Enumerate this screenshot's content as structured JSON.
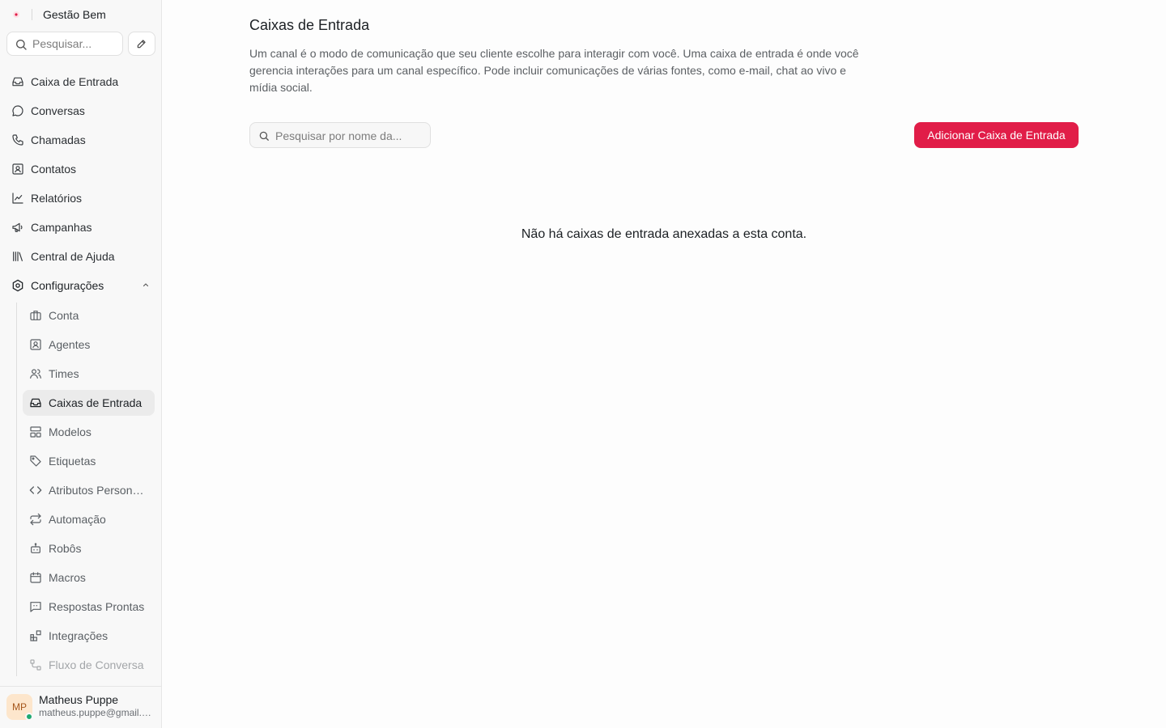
{
  "app": {
    "name": "Gestão Bem"
  },
  "colors": {
    "accent": "#e11d48",
    "online": "#1fa971",
    "avatar_bg": "#fde6cc"
  },
  "sidebar": {
    "search_placeholder": "Pesquisar...",
    "items": [
      {
        "label": "Caixa de Entrada",
        "icon": "inbox-icon"
      },
      {
        "label": "Conversas",
        "icon": "chat-bubble-icon"
      },
      {
        "label": "Chamadas",
        "icon": "phone-icon"
      },
      {
        "label": "Contatos",
        "icon": "contact-card-icon"
      },
      {
        "label": "Relatórios",
        "icon": "line-chart-icon"
      },
      {
        "label": "Campanhas",
        "icon": "megaphone-icon"
      },
      {
        "label": "Central de Ajuda",
        "icon": "library-icon"
      },
      {
        "label": "Configurações",
        "icon": "settings-icon",
        "expanded": true
      }
    ],
    "settings_items": [
      {
        "label": "Conta",
        "icon": "briefcase-icon"
      },
      {
        "label": "Agentes",
        "icon": "agent-icon"
      },
      {
        "label": "Times",
        "icon": "users-icon"
      },
      {
        "label": "Caixas de Entrada",
        "icon": "inbox-icon",
        "active": true
      },
      {
        "label": "Modelos",
        "icon": "template-icon"
      },
      {
        "label": "Etiquetas",
        "icon": "tag-icon"
      },
      {
        "label": "Atributos Personalizados",
        "icon": "code-icon"
      },
      {
        "label": "Automação",
        "icon": "repeat-icon"
      },
      {
        "label": "Robôs",
        "icon": "bot-icon"
      },
      {
        "label": "Macros",
        "icon": "calendar-icon"
      },
      {
        "label": "Respostas Prontas",
        "icon": "quote-message-icon"
      },
      {
        "label": "Integrações",
        "icon": "integrations-icon"
      },
      {
        "label": "Fluxo de Conversa",
        "icon": "flow-icon"
      }
    ],
    "user": {
      "initials": "MP",
      "name": "Matheus Puppe",
      "email": "matheus.puppe@gmail.com"
    }
  },
  "main": {
    "title": "Caixas de Entrada",
    "description": "Um canal é o modo de comunicação que seu cliente escolhe para interagir com você. Uma caixa de entrada é onde você gerencia interações para um canal específico. Pode incluir comunicações de várias fontes, como e-mail, chat ao vivo e mídia social.",
    "search_placeholder": "Pesquisar por nome da...",
    "add_button": "Adicionar Caixa de Entrada",
    "empty_message": "Não há caixas de entrada anexadas a esta conta."
  }
}
